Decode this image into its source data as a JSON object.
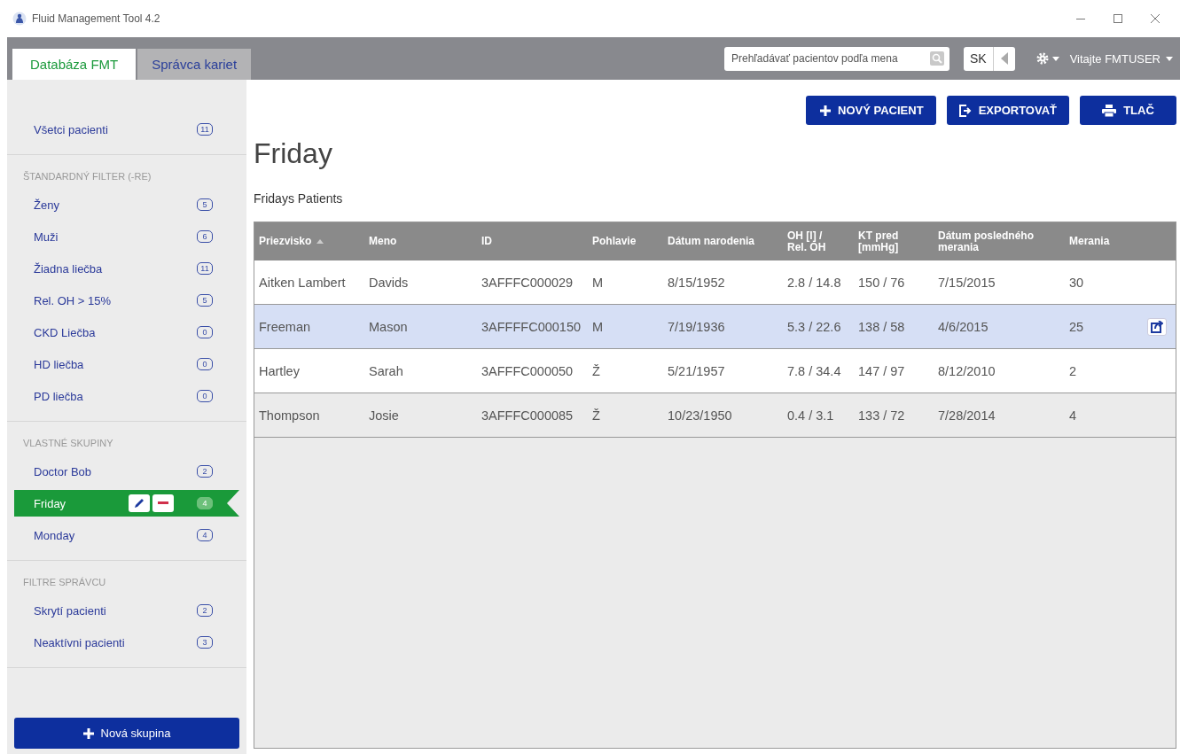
{
  "window": {
    "title": "Fluid Management Tool 4.2"
  },
  "tabs": [
    {
      "label": "Databáza FMT",
      "selected": true
    },
    {
      "label": "Správca kariet",
      "selected": false
    }
  ],
  "search": {
    "placeholder": "Prehľadávať pacientov podľa mena"
  },
  "language": "SK",
  "user_menu": "Vitajte FMTUSER",
  "sidebar": {
    "sections": [
      {
        "items": [
          {
            "label": "Všetci pacienti",
            "count": "11",
            "selected": false
          }
        ]
      },
      {
        "heading": "ŠTANDARDNÝ FILTER (-RE)",
        "items": [
          {
            "label": "Ženy",
            "count": "5",
            "selected": false
          },
          {
            "label": "Muži",
            "count": "6",
            "selected": false
          },
          {
            "label": "Žiadna liečba",
            "count": "11",
            "selected": false
          },
          {
            "label": "Rel. OH > 15%",
            "count": "5",
            "selected": false
          },
          {
            "label": "CKD Liečba",
            "count": "0",
            "selected": false
          },
          {
            "label": "HD liečba",
            "count": "0",
            "selected": false
          },
          {
            "label": "PD liečba",
            "count": "0",
            "selected": false
          }
        ]
      },
      {
        "heading": "VLASTNÉ SKUPINY",
        "items": [
          {
            "label": "Doctor Bob",
            "count": "2",
            "selected": false
          },
          {
            "label": "Friday",
            "count": "4",
            "selected": true
          },
          {
            "label": "Monday",
            "count": "4",
            "selected": false
          }
        ]
      },
      {
        "heading": "FILTRE SPRÁVCU",
        "items": [
          {
            "label": "Skrytí pacienti",
            "count": "2",
            "selected": false
          },
          {
            "label": "Neaktívni pacienti",
            "count": "3",
            "selected": false
          }
        ]
      }
    ],
    "new_group_button": "Nová skupina"
  },
  "toolbar": [
    {
      "kind": "add",
      "label": "NOVÝ PACIENT"
    },
    {
      "kind": "export",
      "label": "EXPORTOVAŤ"
    },
    {
      "kind": "print",
      "label": "TLAČ"
    }
  ],
  "group": {
    "title": "Friday",
    "description": "Fridays Patients"
  },
  "table": {
    "columns": [
      {
        "label": "Priezvisko",
        "sorted": true
      },
      {
        "label": "Meno",
        "sorted": false
      },
      {
        "label": "ID",
        "sorted": false
      },
      {
        "label": "Pohlavie",
        "sorted": false
      },
      {
        "label": "Dátum narodenia",
        "sorted": false
      },
      {
        "label": "OH [l] /\nRel. OH",
        "sorted": false
      },
      {
        "label": "KT pred\n[mmHg]",
        "sorted": false
      },
      {
        "label": "Dátum posledného\nmerania",
        "sorted": false
      },
      {
        "label": "Merania",
        "sorted": false
      }
    ],
    "rows": [
      {
        "cells": [
          "Aitken Lambert",
          "Davids",
          "3AFFFC000029",
          "M",
          "8/15/1952",
          "2.8 / 14.8",
          "150 / 76",
          "7/15/2015",
          "30"
        ],
        "selected": false
      },
      {
        "cells": [
          "Freeman",
          "Mason",
          "3AFFFFC000150",
          "M",
          "7/19/1936",
          "5.3 / 22.6",
          "138 / 58",
          "4/6/2015",
          "25"
        ],
        "selected": true
      },
      {
        "cells": [
          "Hartley",
          "Sarah",
          "3AFFFC000050",
          "Ž",
          "5/21/1957",
          "7.8 / 34.4",
          "147 / 97",
          "8/12/2010",
          "2"
        ],
        "selected": false
      },
      {
        "cells": [
          "Thompson",
          "Josie",
          "3AFFFC000085",
          "Ž",
          "10/23/1950",
          "0.4 / 3.1",
          "133 / 72",
          "7/28/2014",
          "4"
        ],
        "selected": false
      }
    ]
  }
}
